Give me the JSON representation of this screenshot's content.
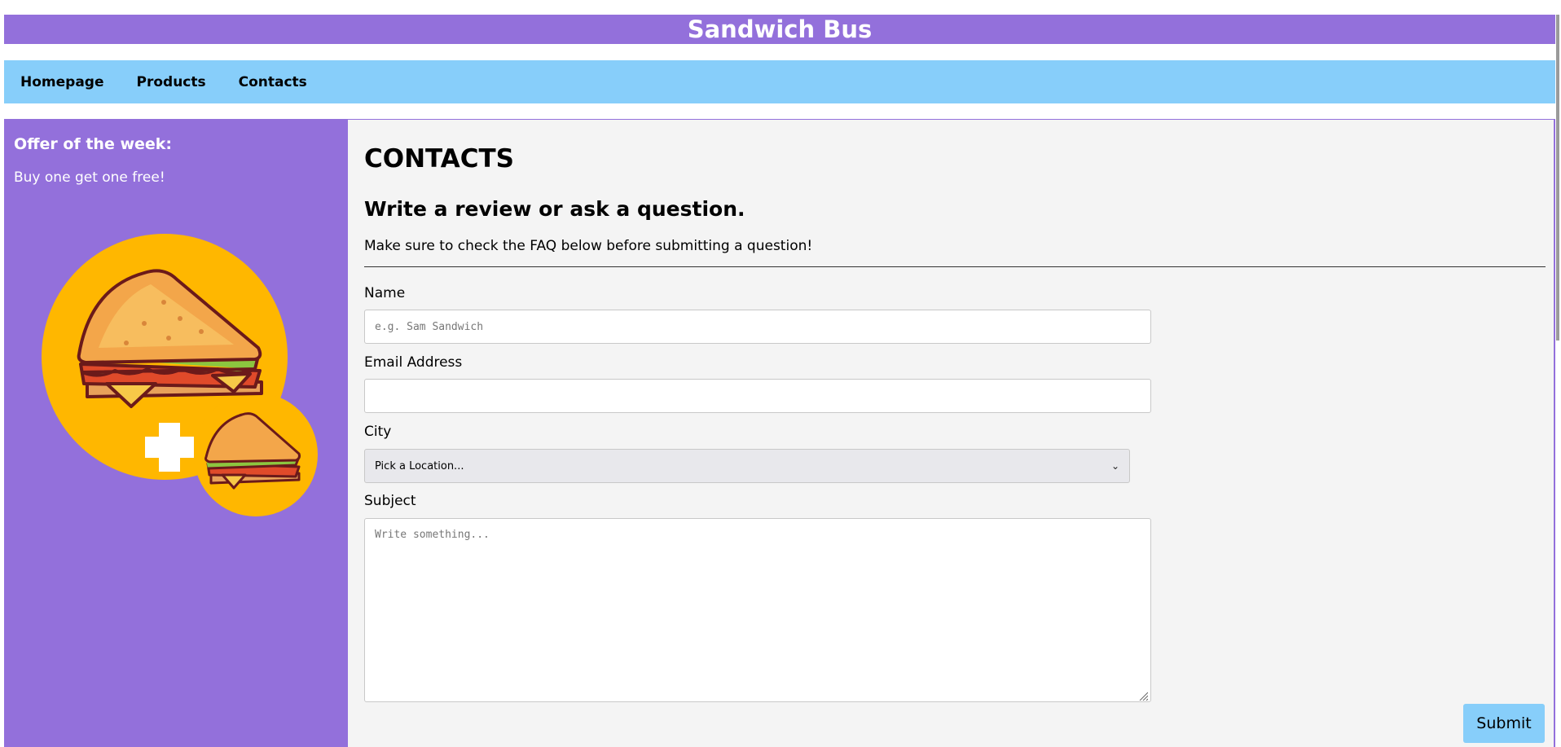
{
  "site": {
    "title": "Sandwich Bus"
  },
  "nav": {
    "items": [
      {
        "label": "Homepage"
      },
      {
        "label": "Products"
      },
      {
        "label": "Contacts"
      }
    ]
  },
  "sidebar": {
    "offer_title": "Offer of the week:",
    "offer_text": "Buy one get one free!",
    "image_icon": "sandwich-plus-sandwich-icon"
  },
  "main": {
    "heading": "CONTACTS",
    "subheading": "Write a review or ask a question.",
    "intro": "Make sure to check the FAQ below before submitting a question!",
    "form": {
      "name_label": "Name",
      "name_placeholder": "e.g. Sam Sandwich",
      "email_label": "Email Address",
      "city_label": "City",
      "city_selected": "Pick a Location...",
      "subject_label": "Subject",
      "subject_placeholder": "Write something...",
      "submit_label": "Submit"
    }
  },
  "colors": {
    "purple": "#9370db",
    "light_blue": "#87cefa",
    "panel_bg": "#f4f4f4",
    "sandwich_yellow": "#ffb700"
  }
}
